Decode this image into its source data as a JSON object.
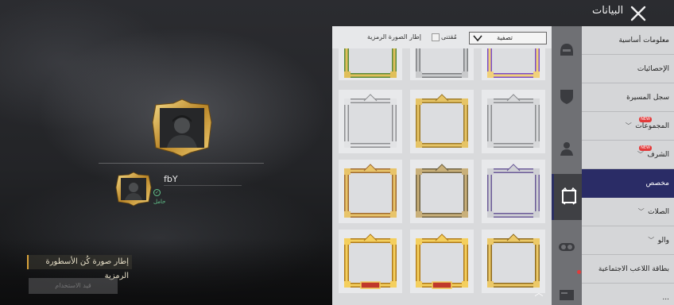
{
  "window": {
    "title": "البيانات"
  },
  "preview": {
    "player_name": "fbY",
    "status_label": "حامل",
    "legend_label": "إطار صورة كُن الأسطورة الرمزية",
    "use_button_label": "قيد الاستخدام"
  },
  "frames_panel": {
    "title": "إطار الصورة الرمزية",
    "owned_label": "مُقتنى",
    "filter_value": "تصفية",
    "frames": [
      {
        "style": "purple-gold"
      },
      {
        "style": "silver-ornate"
      },
      {
        "style": "green-gold"
      },
      {
        "style": "silver-plain"
      },
      {
        "style": "gold-plain"
      },
      {
        "style": "silver-star"
      },
      {
        "style": "purple-silver"
      },
      {
        "style": "bronze"
      },
      {
        "style": "gold-wing"
      },
      {
        "style": "gold-ornate"
      },
      {
        "style": "gold-crown"
      },
      {
        "style": "gold-crown"
      }
    ]
  },
  "icon_tabs": [
    {
      "icon": "helmet-icon"
    },
    {
      "icon": "shield-icon"
    },
    {
      "icon": "person-icon"
    },
    {
      "icon": "frame-icon",
      "active": true
    },
    {
      "icon": "toggle-icon"
    },
    {
      "icon": "card-icon"
    }
  ],
  "sidebar": {
    "items": [
      {
        "label": "معلومات أساسية"
      },
      {
        "label": "الإحصائيات"
      },
      {
        "label": "سجل المسيرة"
      },
      {
        "label": "المجموعات",
        "badge": "NEW",
        "chevron": true
      },
      {
        "label": "الشرف",
        "badge": "NEW",
        "chevron": true
      },
      {
        "label": "مخصص",
        "active": true
      },
      {
        "label": "الصلات",
        "chevron": true
      },
      {
        "label": "والو",
        "chevron": true
      },
      {
        "label": "بطاقة اللاعب الاجتماعية"
      },
      {
        "label": "..."
      }
    ]
  },
  "colors": {
    "accent": "#2a2c66",
    "gold": "#d8a23a",
    "status_green": "#63c48c",
    "badge_red": "#e23b3b"
  }
}
